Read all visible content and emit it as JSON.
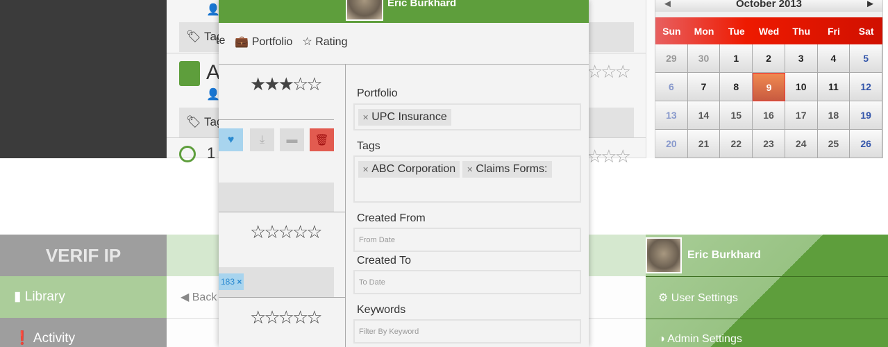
{
  "library_bg": {
    "tag_label": "Tag",
    "doc_title_initial": "A",
    "row3_initial": "1"
  },
  "calendar": {
    "month": "October",
    "year": "2013",
    "prev": "◄",
    "next": "►",
    "weekdays": [
      "Sun",
      "Mon",
      "Tue",
      "Wed",
      "Thu",
      "Fri",
      "Sat"
    ],
    "weeks": [
      [
        "29",
        "30",
        "1",
        "2",
        "3",
        "4",
        "5"
      ],
      [
        "6",
        "7",
        "8",
        "9",
        "10",
        "11",
        "12"
      ],
      [
        "13",
        "14",
        "15",
        "16",
        "17",
        "18",
        "19"
      ],
      [
        "20",
        "21",
        "22",
        "23",
        "24",
        "25",
        "26"
      ]
    ],
    "selected": "9",
    "header_color": "#ee1a00"
  },
  "sidebar": {
    "logo": "VERIF IP",
    "items": [
      {
        "label": "Library",
        "icon": "book-icon"
      },
      {
        "label": "Activity",
        "icon": "exclamation-icon"
      }
    ]
  },
  "content": {
    "back_label": "Back"
  },
  "user_menu": {
    "name": "Eric Burkhard",
    "items": [
      {
        "label": "User Settings",
        "icon": "gear-icon"
      },
      {
        "label": "Admin Settings",
        "icon": "contrast-icon"
      }
    ]
  },
  "modal": {
    "user_name": "Eric Burkhard",
    "tabs": [
      {
        "label": "te",
        "icon": ""
      },
      {
        "label": "Portfolio",
        "icon": "briefcase-icon"
      },
      {
        "label": "Rating",
        "icon": "star-icon"
      }
    ],
    "ratings": [
      3,
      0,
      0
    ],
    "max_rating": 5,
    "tag_fragment": "183",
    "filters": {
      "portfolio_label": "Portfolio",
      "portfolio_values": [
        "UPC Insurance"
      ],
      "tags_label": "Tags",
      "tags_values": [
        "ABC Corporation",
        "Claims Forms:"
      ],
      "created_from_label": "Created From",
      "created_from_placeholder": "From Date",
      "created_to_label": "Created To",
      "created_to_placeholder": "To Date",
      "keywords_label": "Keywords",
      "keywords_placeholder": "Filter By Keyword"
    }
  },
  "colors": {
    "brand_green": "#5e9e3c",
    "light_green": "#abcd9a",
    "favorite_blue": "#a8d4ee",
    "delete_red": "#e25b50"
  }
}
